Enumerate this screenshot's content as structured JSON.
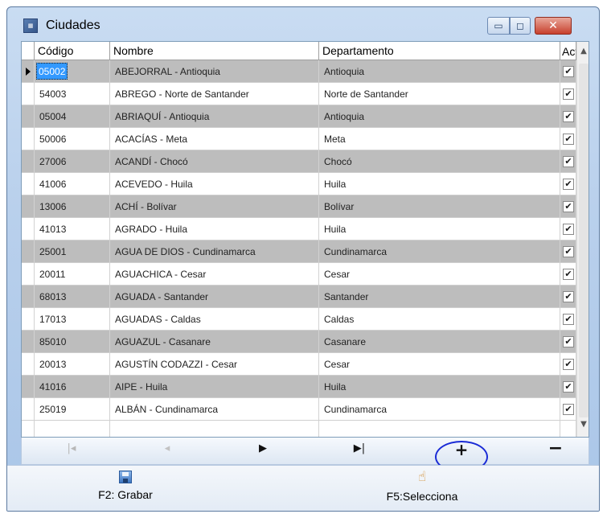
{
  "window": {
    "title": "Ciudades",
    "icon": "city-app-icon",
    "controls": {
      "minimize": "▭",
      "maximize": "◻",
      "close": "✕"
    }
  },
  "grid": {
    "columns": {
      "codigo": "Código",
      "nombre": "Nombre",
      "departamento": "Departamento",
      "activo": "Act"
    },
    "rows": [
      {
        "codigo": "05002",
        "nombre": "ABEJORRAL - Antioquia",
        "departamento": "Antioquia",
        "activo": "✔"
      },
      {
        "codigo": "54003",
        "nombre": "ABREGO - Norte de Santander",
        "departamento": "Norte de Santander",
        "activo": "✔"
      },
      {
        "codigo": "05004",
        "nombre": "ABRIAQUÍ - Antioquia",
        "departamento": "Antioquia",
        "activo": "✔"
      },
      {
        "codigo": "50006",
        "nombre": "ACACÍAS - Meta",
        "departamento": "Meta",
        "activo": "✔"
      },
      {
        "codigo": "27006",
        "nombre": "ACANDÍ - Chocó",
        "departamento": "Chocó",
        "activo": "✔"
      },
      {
        "codigo": "41006",
        "nombre": "ACEVEDO - Huila",
        "departamento": "Huila",
        "activo": "✔"
      },
      {
        "codigo": "13006",
        "nombre": "ACHÍ - Bolívar",
        "departamento": "Bolívar",
        "activo": "✔"
      },
      {
        "codigo": "41013",
        "nombre": "AGRADO - Huila",
        "departamento": "Huila",
        "activo": "✔"
      },
      {
        "codigo": "25001",
        "nombre": "AGUA DE DIOS - Cundinamarca",
        "departamento": "Cundinamarca",
        "activo": "✔"
      },
      {
        "codigo": "20011",
        "nombre": "AGUACHICA - Cesar",
        "departamento": "Cesar",
        "activo": "✔"
      },
      {
        "codigo": "68013",
        "nombre": "AGUADA - Santander",
        "departamento": "Santander",
        "activo": "✔"
      },
      {
        "codigo": "17013",
        "nombre": "AGUADAS - Caldas",
        "departamento": "Caldas",
        "activo": "✔"
      },
      {
        "codigo": "85010",
        "nombre": "AGUAZUL - Casanare",
        "departamento": "Casanare",
        "activo": "✔"
      },
      {
        "codigo": "20013",
        "nombre": "AGUSTÍN CODAZZI - Cesar",
        "departamento": "Cesar",
        "activo": "✔"
      },
      {
        "codigo": "41016",
        "nombre": "AIPE - Huila",
        "departamento": "Huila",
        "activo": "✔"
      },
      {
        "codigo": "25019",
        "nombre": "ALBÁN - Cundinamarca",
        "departamento": "Cundinamarca",
        "activo": "✔"
      }
    ],
    "scroll": {
      "up": "▲",
      "down": "▼"
    }
  },
  "navigator": {
    "first": "|◂",
    "prev": "◂",
    "next": "▶",
    "last": "▶|",
    "add": "+",
    "delete": "−"
  },
  "actions": {
    "grabar_label": "F2: Grabar",
    "selecciona_label": "F5:Selecciona",
    "hand_glyph": "☝"
  },
  "colors": {
    "selection": "#3399ff",
    "alt_row": "#bdbdbd",
    "annotation_circle": "#1a2bd6",
    "close_button": "#c7402d"
  }
}
